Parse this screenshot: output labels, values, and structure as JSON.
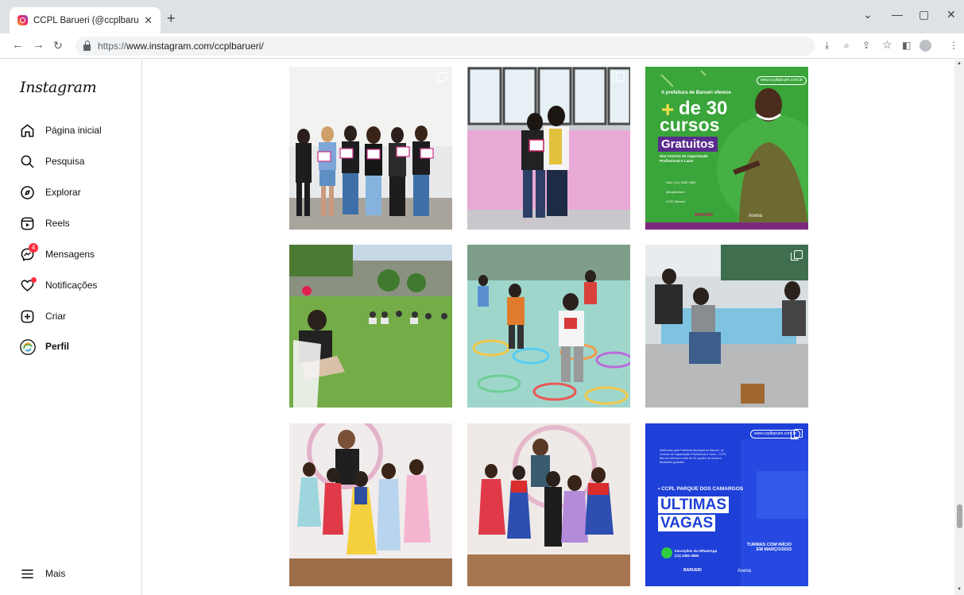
{
  "browser": {
    "tab_title": "CCPL Barueri (@ccplbarueri) • Fo",
    "tab_close": "✕",
    "new_tab": "+",
    "url_prefix": "https://",
    "url_main": "www.instagram.com/ccplbarueri/",
    "window_controls": [
      "⌄",
      "—",
      "▢",
      "✕"
    ]
  },
  "sidebar": {
    "logo": "Instagram",
    "items": [
      {
        "label": "Página inicial",
        "icon": "home-icon"
      },
      {
        "label": "Pesquisa",
        "icon": "search-icon"
      },
      {
        "label": "Explorar",
        "icon": "compass-icon"
      },
      {
        "label": "Reels",
        "icon": "reels-icon"
      },
      {
        "label": "Mensagens",
        "icon": "messenger-icon",
        "badge": "4"
      },
      {
        "label": "Notificações",
        "icon": "heart-icon"
      },
      {
        "label": "Criar",
        "icon": "plus-square-icon"
      },
      {
        "label": "Perfil",
        "icon": "avatar"
      }
    ],
    "more": "Mais"
  },
  "posts": {
    "p3": {
      "site": "www.ccplbarueri.com.br",
      "intro": "A prefeitura de Barueri oferece",
      "plus": "+",
      "count": "de 30",
      "word": "cursos",
      "badge": "Gratuitos",
      "sub": "Nos Centros de Capacitação Profissional e Lazer",
      "contacts": [
        "SAU: (11) 4382-4684",
        "@ccplbarueri",
        "CCPL Barueri"
      ],
      "brand1": "BARUERI",
      "brand2": "Asena"
    },
    "p9": {
      "site": "www.ccplbarueri.com.br",
      "blurb": "Matrículas pela Prefeitura Municipal de Barueri, os Centros de Capacitação Profissional e Lazer - CCPL Barueri oferecem mais de 30 opções de cursos e atividades gratuitas",
      "place": "• CCPL PARQUE DOS CAMARGOS",
      "line1": "ÚLTIMAS",
      "line2": "VAGAS",
      "whats": "Inscrições via WhatsApp (11) 4382-4684",
      "turmas": "TURMAS COM INÍCIO EM MARÇO/2023",
      "brand1": "BARUERI",
      "brand2": "Asena"
    }
  },
  "colors": {
    "poster_green": "#3aa53a",
    "poster_blue": "#1e3fd8",
    "gratuitos_bg": "#5b2c8f",
    "badge_red": "#ff3040"
  }
}
